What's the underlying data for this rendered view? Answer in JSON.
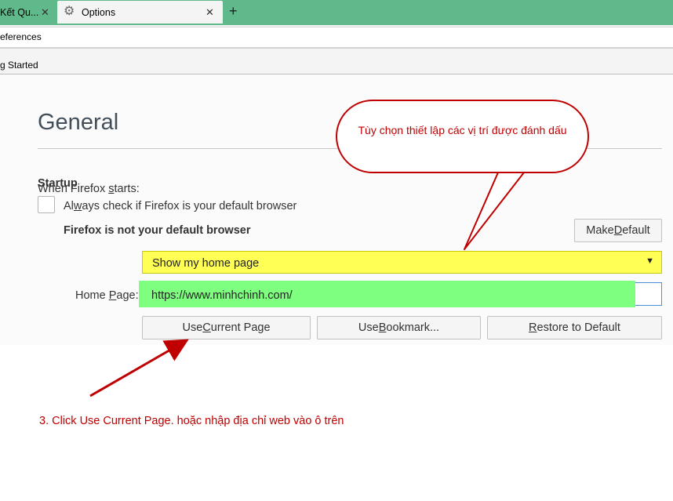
{
  "tabs": [
    {
      "label": "Kết Qu...",
      "close": "✕"
    },
    {
      "label": "Options",
      "close": "✕",
      "icon": "gear-icon"
    }
  ],
  "new_tab": "+",
  "urlbar": {
    "value": "eferences"
  },
  "bookmarks": {
    "item": "g Started"
  },
  "general": {
    "heading": "General",
    "startup_label": "Startup",
    "always_check_pre": "Al",
    "always_check_u": "w",
    "always_check_post": "ays check if Firefox is your default browser",
    "not_default": "Firefox is not your default browser",
    "make_default_pre": "Make ",
    "make_default_u": "D",
    "make_default_post": "efault",
    "when_starts_pre": "When Firefox ",
    "when_starts_u": "s",
    "when_starts_post": "tarts:",
    "start_option": "Show my home page",
    "home_page_pre": "Home ",
    "home_page_u": "P",
    "home_page_post": "age:",
    "home_page_value": "https://www.minhchinh.com/",
    "use_current_pre": "Use ",
    "use_current_u": "C",
    "use_current_post": "urrent Page",
    "use_bookmark_pre": "Use ",
    "use_bookmark_u": "B",
    "use_bookmark_post": "ookmark...",
    "restore_u": "R",
    "restore_post": "estore to Default"
  },
  "annotations": {
    "callout": "Tùy chọn thiết lập các vị trí được đánh dấu",
    "caption": "3. Click Use Current Page. hoặc nhập địa chỉ web vào ô trên",
    "color": "#c00000"
  },
  "colors": {
    "tabbar": "#5fb98a",
    "highlight_yellow": "#ffff55",
    "highlight_green": "#7fff7f"
  }
}
